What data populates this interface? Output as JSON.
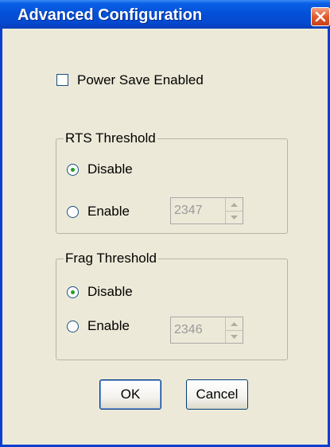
{
  "window": {
    "title": "Advanced Configuration"
  },
  "power_save": {
    "label": "Power Save Enabled",
    "checked": false
  },
  "rts_threshold": {
    "title": "RTS Threshold",
    "disable_label": "Disable",
    "enable_label": "Enable",
    "selected": "Disable",
    "value": "2347"
  },
  "frag_threshold": {
    "title": "Frag Threshold",
    "disable_label": "Disable",
    "enable_label": "Enable",
    "selected": "Disable",
    "value": "2346"
  },
  "buttons": {
    "ok_label": "OK",
    "cancel_label": "Cancel"
  },
  "icons": {
    "close": "close-icon",
    "spin_up": "chevron-up-icon",
    "spin_down": "chevron-down-icon"
  },
  "colors": {
    "titlebar": "#0451d8",
    "dialog_bg": "#ece9d8",
    "close_button": "#e35a2c",
    "radio_dot": "#21a121"
  }
}
